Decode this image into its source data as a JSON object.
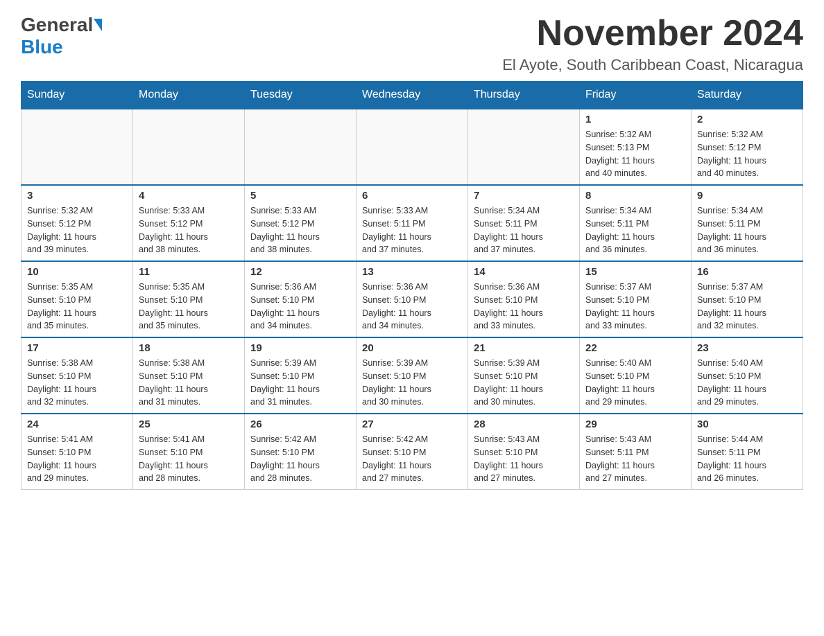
{
  "logo": {
    "general": "General",
    "blue": "Blue",
    "line2": "Blue"
  },
  "header": {
    "title": "November 2024",
    "subtitle": "El Ayote, South Caribbean Coast, Nicaragua"
  },
  "weekdays": [
    "Sunday",
    "Monday",
    "Tuesday",
    "Wednesday",
    "Thursday",
    "Friday",
    "Saturday"
  ],
  "weeks": [
    {
      "days": [
        {
          "num": "",
          "info": ""
        },
        {
          "num": "",
          "info": ""
        },
        {
          "num": "",
          "info": ""
        },
        {
          "num": "",
          "info": ""
        },
        {
          "num": "",
          "info": ""
        },
        {
          "num": "1",
          "info": "Sunrise: 5:32 AM\nSunset: 5:13 PM\nDaylight: 11 hours\nand 40 minutes."
        },
        {
          "num": "2",
          "info": "Sunrise: 5:32 AM\nSunset: 5:12 PM\nDaylight: 11 hours\nand 40 minutes."
        }
      ]
    },
    {
      "days": [
        {
          "num": "3",
          "info": "Sunrise: 5:32 AM\nSunset: 5:12 PM\nDaylight: 11 hours\nand 39 minutes."
        },
        {
          "num": "4",
          "info": "Sunrise: 5:33 AM\nSunset: 5:12 PM\nDaylight: 11 hours\nand 38 minutes."
        },
        {
          "num": "5",
          "info": "Sunrise: 5:33 AM\nSunset: 5:12 PM\nDaylight: 11 hours\nand 38 minutes."
        },
        {
          "num": "6",
          "info": "Sunrise: 5:33 AM\nSunset: 5:11 PM\nDaylight: 11 hours\nand 37 minutes."
        },
        {
          "num": "7",
          "info": "Sunrise: 5:34 AM\nSunset: 5:11 PM\nDaylight: 11 hours\nand 37 minutes."
        },
        {
          "num": "8",
          "info": "Sunrise: 5:34 AM\nSunset: 5:11 PM\nDaylight: 11 hours\nand 36 minutes."
        },
        {
          "num": "9",
          "info": "Sunrise: 5:34 AM\nSunset: 5:11 PM\nDaylight: 11 hours\nand 36 minutes."
        }
      ]
    },
    {
      "days": [
        {
          "num": "10",
          "info": "Sunrise: 5:35 AM\nSunset: 5:10 PM\nDaylight: 11 hours\nand 35 minutes."
        },
        {
          "num": "11",
          "info": "Sunrise: 5:35 AM\nSunset: 5:10 PM\nDaylight: 11 hours\nand 35 minutes."
        },
        {
          "num": "12",
          "info": "Sunrise: 5:36 AM\nSunset: 5:10 PM\nDaylight: 11 hours\nand 34 minutes."
        },
        {
          "num": "13",
          "info": "Sunrise: 5:36 AM\nSunset: 5:10 PM\nDaylight: 11 hours\nand 34 minutes."
        },
        {
          "num": "14",
          "info": "Sunrise: 5:36 AM\nSunset: 5:10 PM\nDaylight: 11 hours\nand 33 minutes."
        },
        {
          "num": "15",
          "info": "Sunrise: 5:37 AM\nSunset: 5:10 PM\nDaylight: 11 hours\nand 33 minutes."
        },
        {
          "num": "16",
          "info": "Sunrise: 5:37 AM\nSunset: 5:10 PM\nDaylight: 11 hours\nand 32 minutes."
        }
      ]
    },
    {
      "days": [
        {
          "num": "17",
          "info": "Sunrise: 5:38 AM\nSunset: 5:10 PM\nDaylight: 11 hours\nand 32 minutes."
        },
        {
          "num": "18",
          "info": "Sunrise: 5:38 AM\nSunset: 5:10 PM\nDaylight: 11 hours\nand 31 minutes."
        },
        {
          "num": "19",
          "info": "Sunrise: 5:39 AM\nSunset: 5:10 PM\nDaylight: 11 hours\nand 31 minutes."
        },
        {
          "num": "20",
          "info": "Sunrise: 5:39 AM\nSunset: 5:10 PM\nDaylight: 11 hours\nand 30 minutes."
        },
        {
          "num": "21",
          "info": "Sunrise: 5:39 AM\nSunset: 5:10 PM\nDaylight: 11 hours\nand 30 minutes."
        },
        {
          "num": "22",
          "info": "Sunrise: 5:40 AM\nSunset: 5:10 PM\nDaylight: 11 hours\nand 29 minutes."
        },
        {
          "num": "23",
          "info": "Sunrise: 5:40 AM\nSunset: 5:10 PM\nDaylight: 11 hours\nand 29 minutes."
        }
      ]
    },
    {
      "days": [
        {
          "num": "24",
          "info": "Sunrise: 5:41 AM\nSunset: 5:10 PM\nDaylight: 11 hours\nand 29 minutes."
        },
        {
          "num": "25",
          "info": "Sunrise: 5:41 AM\nSunset: 5:10 PM\nDaylight: 11 hours\nand 28 minutes."
        },
        {
          "num": "26",
          "info": "Sunrise: 5:42 AM\nSunset: 5:10 PM\nDaylight: 11 hours\nand 28 minutes."
        },
        {
          "num": "27",
          "info": "Sunrise: 5:42 AM\nSunset: 5:10 PM\nDaylight: 11 hours\nand 27 minutes."
        },
        {
          "num": "28",
          "info": "Sunrise: 5:43 AM\nSunset: 5:10 PM\nDaylight: 11 hours\nand 27 minutes."
        },
        {
          "num": "29",
          "info": "Sunrise: 5:43 AM\nSunset: 5:11 PM\nDaylight: 11 hours\nand 27 minutes."
        },
        {
          "num": "30",
          "info": "Sunrise: 5:44 AM\nSunset: 5:11 PM\nDaylight: 11 hours\nand 26 minutes."
        }
      ]
    }
  ]
}
